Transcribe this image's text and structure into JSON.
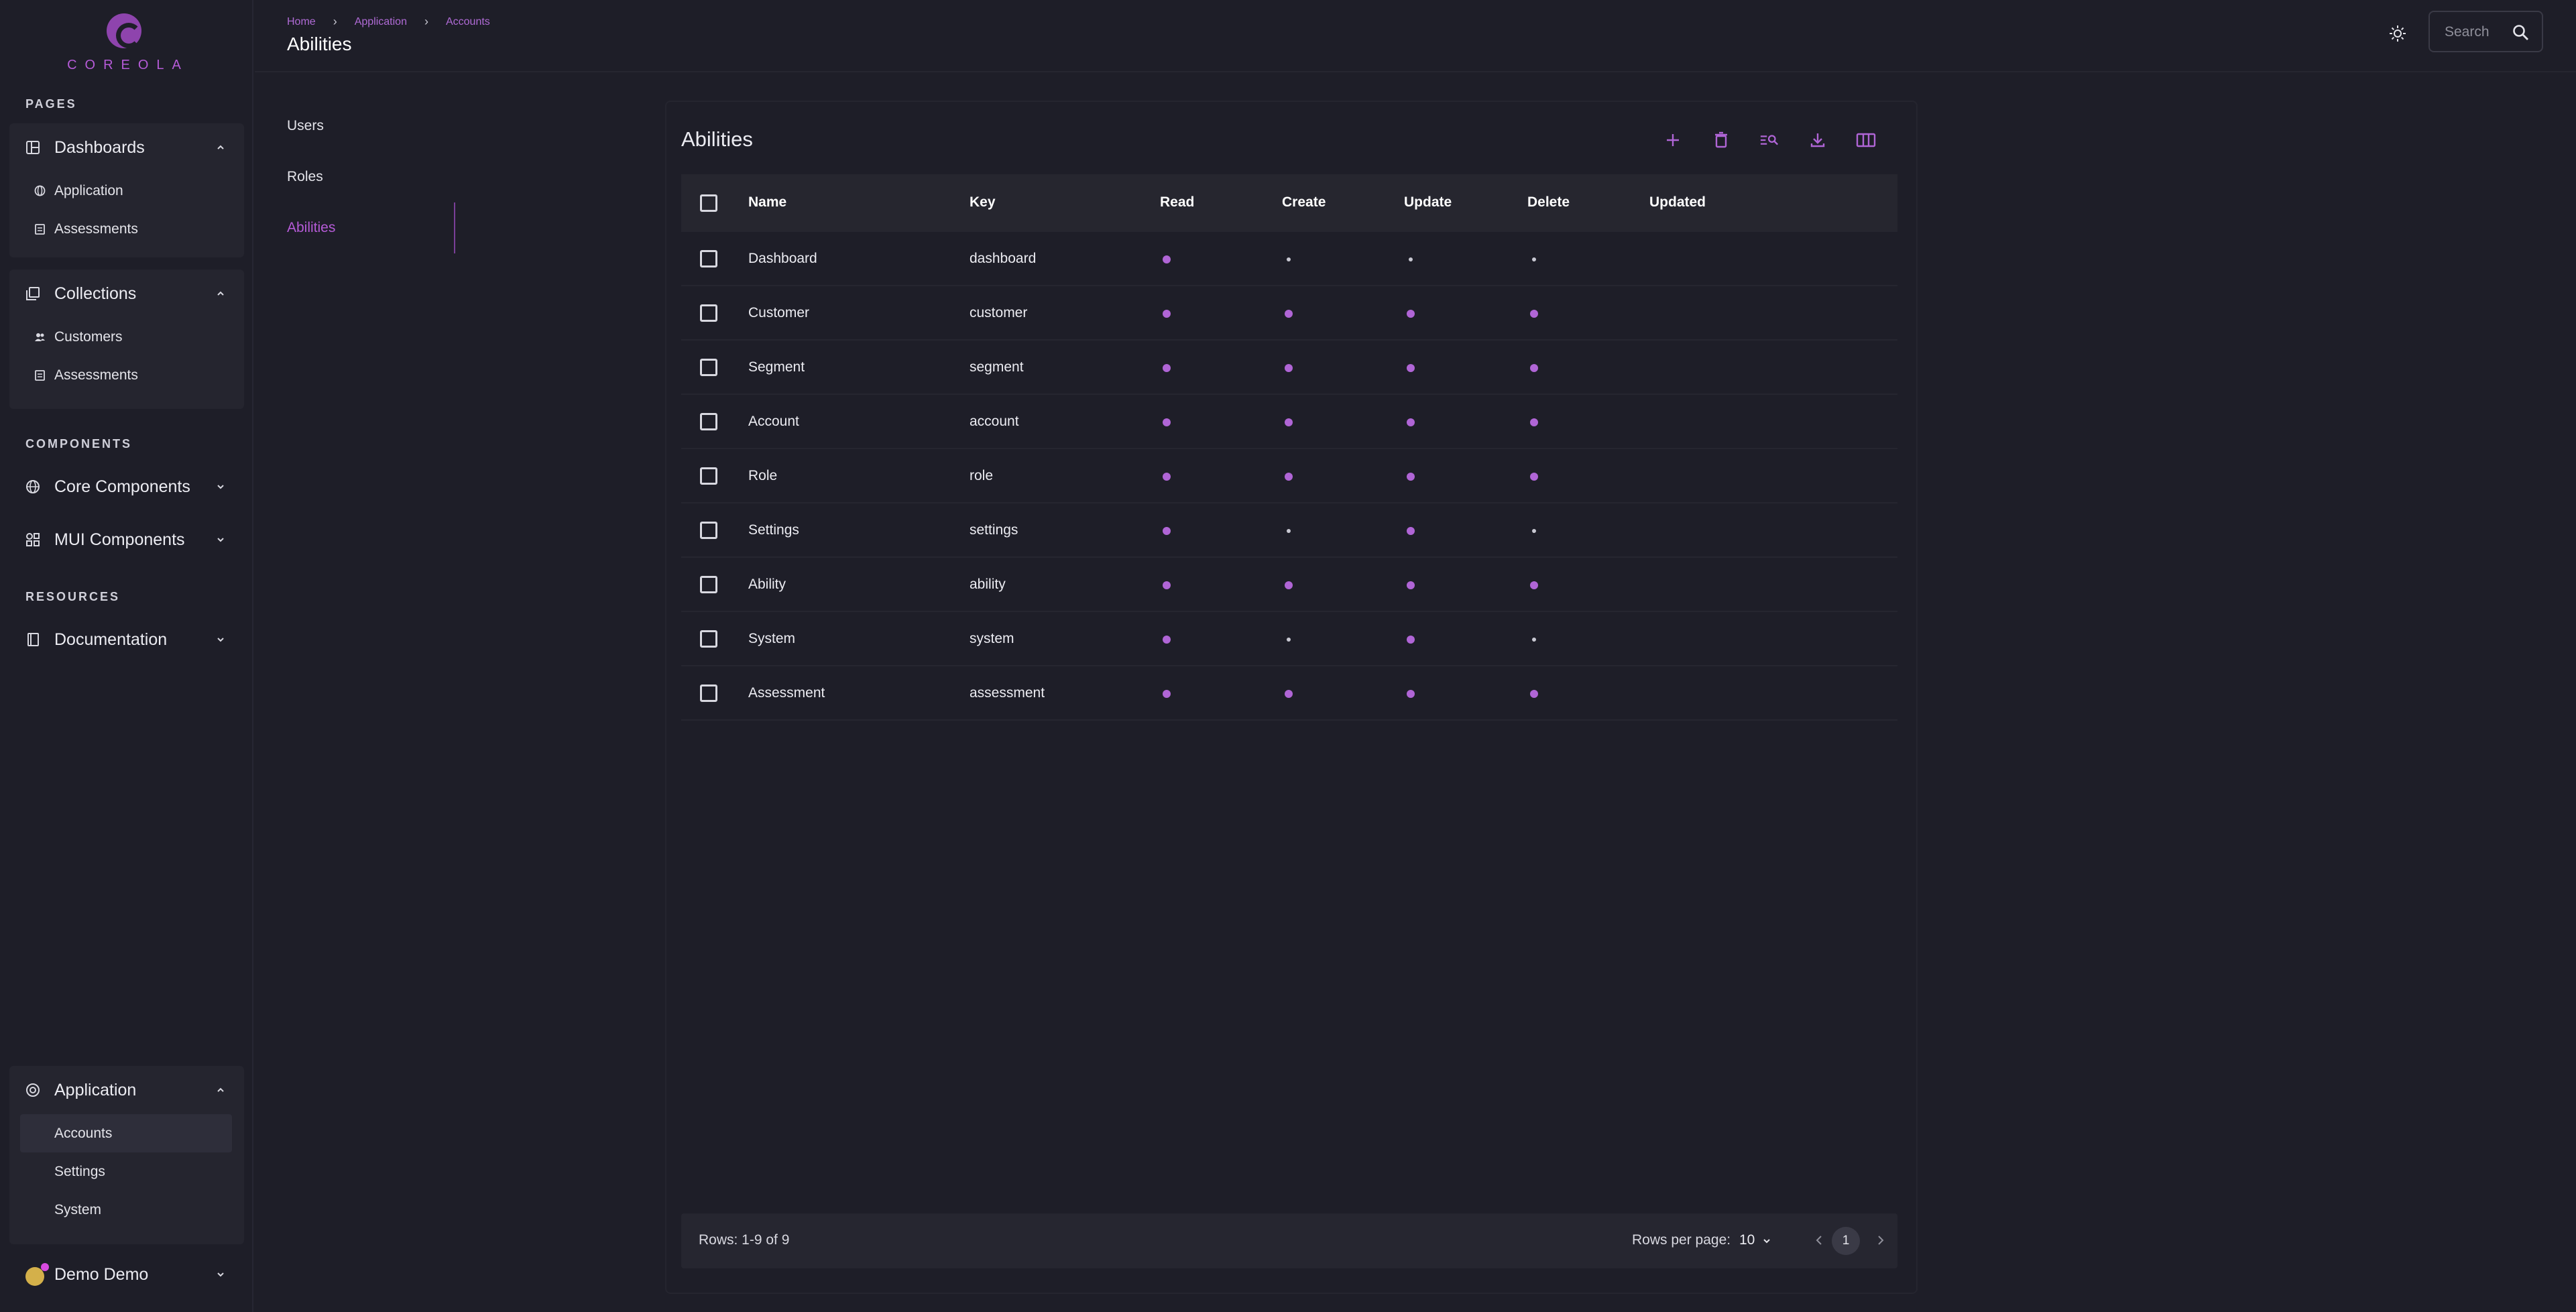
{
  "brand": {
    "name": "COREOLA"
  },
  "sidebar": {
    "sections": {
      "pages": "PAGES",
      "components": "COMPONENTS",
      "resources": "RESOURCES"
    },
    "dashboards": {
      "label": "Dashboards",
      "items": [
        "Application",
        "Assessments"
      ]
    },
    "collections": {
      "label": "Collections",
      "items": [
        "Customers",
        "Assessments"
      ]
    },
    "core_components": "Core Components",
    "mui_components": "MUI Components",
    "documentation": "Documentation",
    "application": {
      "label": "Application",
      "items": [
        "Accounts",
        "Settings",
        "System"
      ]
    },
    "user": "Demo Demo"
  },
  "header": {
    "breadcrumb": [
      "Home",
      "Application",
      "Accounts"
    ],
    "title": "Abilities",
    "search_placeholder": "Search"
  },
  "subnav": {
    "items": [
      "Users",
      "Roles",
      "Abilities"
    ],
    "active": "Abilities"
  },
  "panel": {
    "title": "Abilities",
    "columns": [
      "Name",
      "Key",
      "Read",
      "Create",
      "Update",
      "Delete",
      "Updated"
    ],
    "rows": [
      {
        "name": "Dashboard",
        "key": "dashboard",
        "read": true,
        "create": false,
        "update": false,
        "delete": false
      },
      {
        "name": "Customer",
        "key": "customer",
        "read": true,
        "create": true,
        "update": true,
        "delete": true
      },
      {
        "name": "Segment",
        "key": "segment",
        "read": true,
        "create": true,
        "update": true,
        "delete": true
      },
      {
        "name": "Account",
        "key": "account",
        "read": true,
        "create": true,
        "update": true,
        "delete": true
      },
      {
        "name": "Role",
        "key": "role",
        "read": true,
        "create": true,
        "update": true,
        "delete": true
      },
      {
        "name": "Settings",
        "key": "settings",
        "read": true,
        "create": false,
        "update": true,
        "delete": false
      },
      {
        "name": "Ability",
        "key": "ability",
        "read": true,
        "create": true,
        "update": true,
        "delete": true
      },
      {
        "name": "System",
        "key": "system",
        "read": true,
        "create": false,
        "update": true,
        "delete": false
      },
      {
        "name": "Assessment",
        "key": "assessment",
        "read": true,
        "create": true,
        "update": true,
        "delete": true
      }
    ],
    "footer": {
      "rows_summary": "Rows: 1-9 of 9",
      "rows_per_page_label": "Rows per page:",
      "rows_per_page": "10",
      "page": "1"
    }
  },
  "colors": {
    "accent": "#b065d6",
    "background": "#1e1e28"
  },
  "icons": [
    "theme-icon",
    "search-icon",
    "add-icon",
    "delete-icon",
    "filter-search-icon",
    "download-icon",
    "columns-icon"
  ]
}
